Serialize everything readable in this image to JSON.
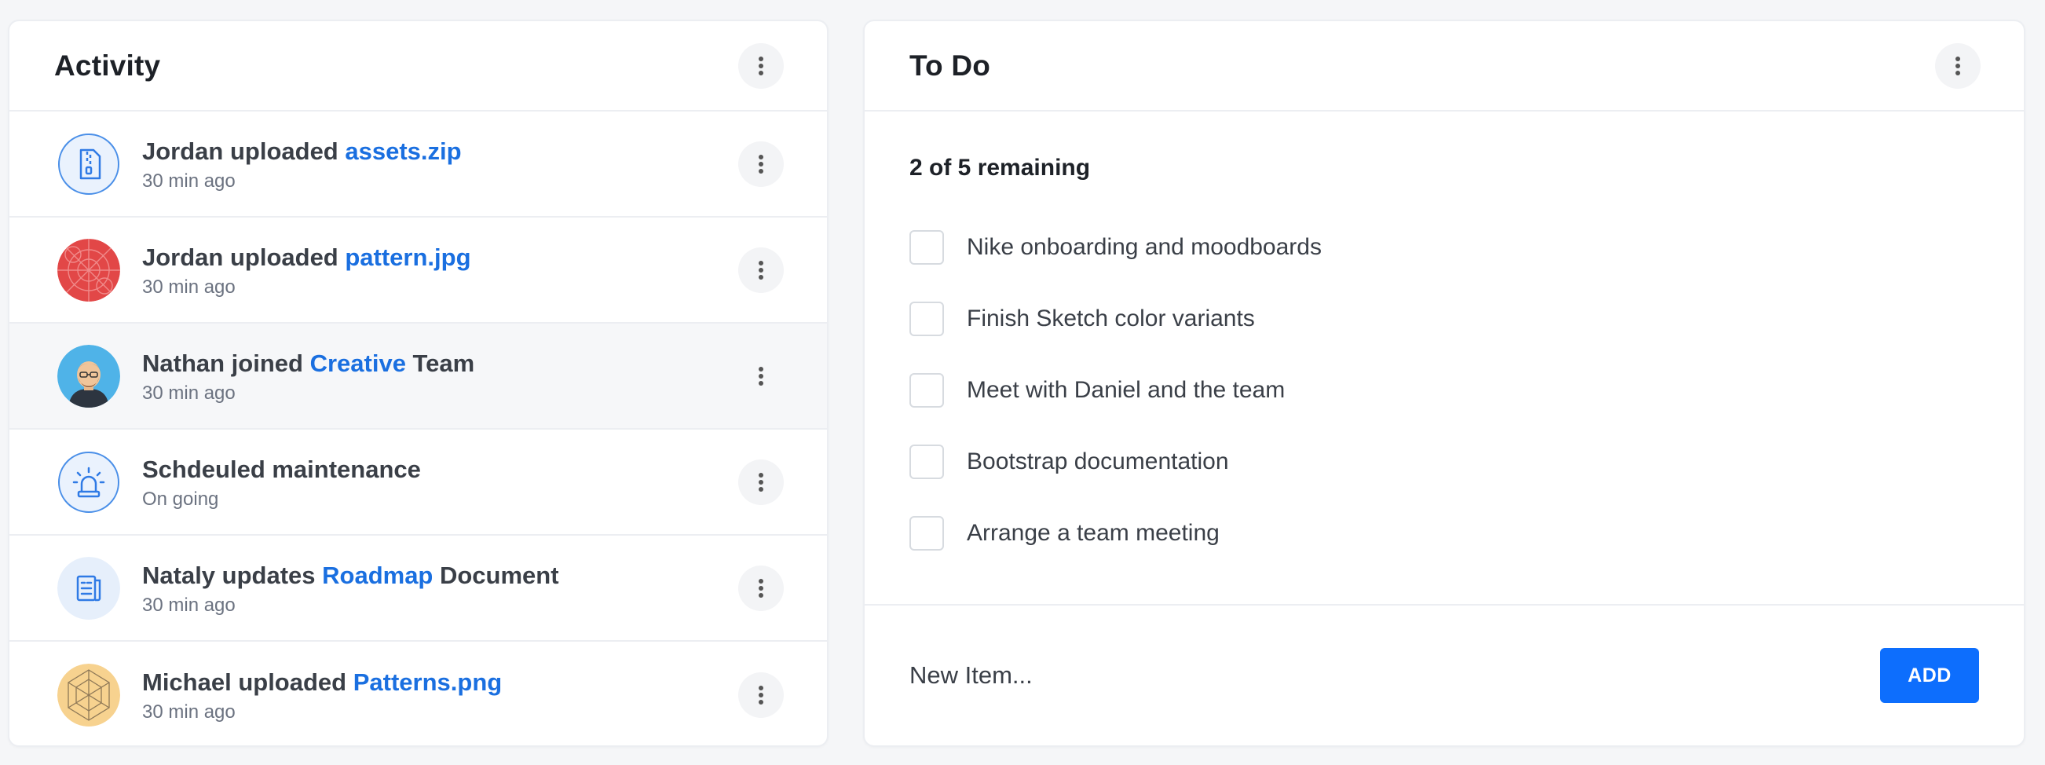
{
  "activity": {
    "title": "Activity",
    "items": [
      {
        "prefix": "Jordan uploaded ",
        "link": "assets.zip",
        "suffix": "",
        "time": "30 min ago",
        "icon": "zip-file-icon"
      },
      {
        "prefix": "Jordan uploaded ",
        "link": "pattern.jpg",
        "suffix": "",
        "time": "30 min ago",
        "icon": "red-pattern-thumbnail"
      },
      {
        "prefix": "Nathan joined ",
        "link": "Creative",
        "suffix": " Team",
        "time": "30 min ago",
        "icon": "user-avatar"
      },
      {
        "prefix": "Schdeuled maintenance",
        "link": "",
        "suffix": "",
        "time": "On going",
        "icon": "alarm-icon"
      },
      {
        "prefix": "Nataly updates ",
        "link": "Roadmap",
        "suffix": " Document",
        "time": "30 min ago",
        "icon": "document-icon"
      },
      {
        "prefix": "Michael uploaded ",
        "link": "Patterns.png",
        "suffix": "",
        "time": "30 min ago",
        "icon": "yellow-pattern-thumbnail"
      }
    ]
  },
  "todo": {
    "title": "To Do",
    "remaining": "2 of 5 remaining",
    "items": [
      {
        "label": "Nike onboarding and moodboards",
        "checked": false
      },
      {
        "label": "Finish Sketch color variants",
        "checked": false
      },
      {
        "label": "Meet with Daniel and the team",
        "checked": false
      },
      {
        "label": "Bootstrap documentation",
        "checked": false
      },
      {
        "label": "Arrange a team meeting",
        "checked": false
      }
    ],
    "new_item_placeholder": "New Item...",
    "add_label": "ADD"
  },
  "colors": {
    "link": "#1a6fe0",
    "primary_button": "#0d6efd",
    "background": "#f5f6f8"
  }
}
